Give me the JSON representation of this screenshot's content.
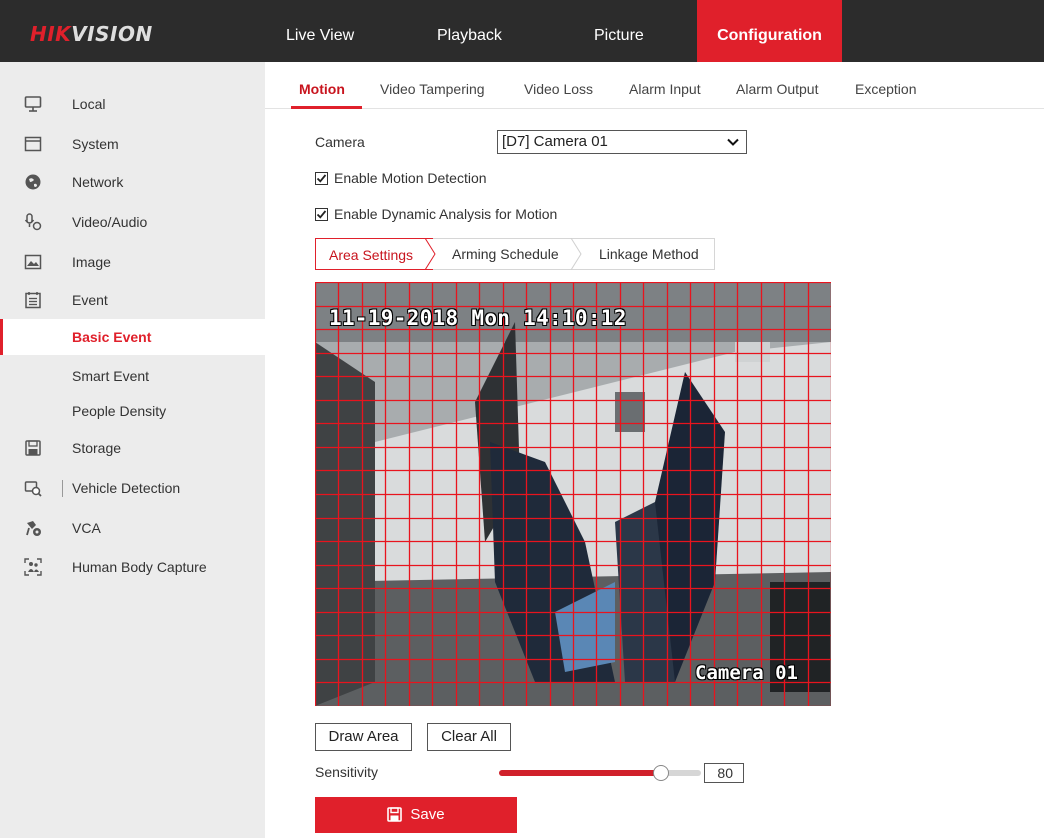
{
  "brand": {
    "logo_part1": "HIK",
    "logo_part2": "VISION"
  },
  "topnav": {
    "live_view": "Live View",
    "playback": "Playback",
    "picture": "Picture",
    "configuration": "Configuration"
  },
  "sidebar": {
    "items": [
      {
        "label": "Local",
        "icon": "monitor-icon"
      },
      {
        "label": "System",
        "icon": "system-icon"
      },
      {
        "label": "Network",
        "icon": "globe-icon"
      },
      {
        "label": "Video/Audio",
        "icon": "video-audio-icon"
      },
      {
        "label": "Image",
        "icon": "image-icon"
      },
      {
        "label": "Event",
        "icon": "event-icon"
      },
      {
        "label": "Basic Event",
        "icon": ""
      },
      {
        "label": "Smart Event",
        "icon": ""
      },
      {
        "label": "People Density",
        "icon": ""
      },
      {
        "label": "Storage",
        "icon": "storage-icon"
      },
      {
        "label": "Vehicle Detection",
        "icon": "vehicle-detection-icon"
      },
      {
        "label": "VCA",
        "icon": "vca-icon"
      },
      {
        "label": "Human Body Capture",
        "icon": "human-body-icon"
      }
    ],
    "active": "Basic Event"
  },
  "tabs": {
    "motion": "Motion",
    "video_tampering": "Video Tampering",
    "video_loss": "Video Loss",
    "alarm_input": "Alarm Input",
    "alarm_output": "Alarm Output",
    "exception": "Exception"
  },
  "form": {
    "camera_label": "Camera",
    "camera_value": "[D7] Camera 01",
    "enable_motion": "Enable Motion Detection",
    "enable_motion_checked": true,
    "enable_dynamic": "Enable Dynamic Analysis for Motion",
    "enable_dynamic_checked": true
  },
  "subtabs": {
    "area_settings": "Area Settings",
    "arming_schedule": "Arming Schedule",
    "linkage_method": "Linkage Method"
  },
  "video": {
    "osd_time": "11-19-2018 Mon 14:10:12",
    "osd_camera": "Camera 01",
    "grid_color": "#e8141e"
  },
  "controls": {
    "draw_area": "Draw Area",
    "clear_all": "Clear All",
    "sensitivity_label": "Sensitivity",
    "sensitivity_value": "80",
    "sensitivity_fraction": 0.8,
    "save": "Save"
  },
  "colors": {
    "accent": "#e0202b",
    "topbar": "#2c2c2c",
    "sidebar": "#ececec"
  }
}
